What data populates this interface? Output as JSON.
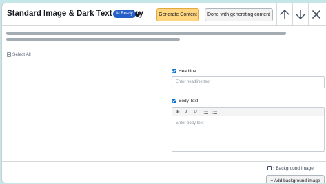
{
  "header": {
    "title": "Standard Image & Dark Text Overlay",
    "badge": "AI Ready",
    "info_icon": "info-icon",
    "generate_label": "Generate Content",
    "done_label": "Done with generating content",
    "up_icon": "arrow-up-icon",
    "down_icon": "arrow-down-icon",
    "close_icon": "close-icon"
  },
  "select_all": "Select All",
  "headline": {
    "label": "Headline",
    "checked": true,
    "placeholder": "Enter headline text"
  },
  "body_text": {
    "label": "Body Text",
    "checked": true,
    "toolbar": {
      "bold": "B",
      "italic": "I",
      "underline": "U"
    },
    "placeholder": "Enter body text"
  },
  "background": {
    "label": "* Background Image",
    "checked": false,
    "add_label": "+ Add background image"
  },
  "colors": {
    "accent_blue": "#0972d3",
    "badge_blue": "#2560c9",
    "generate_bg": "#ffd580",
    "page_bg": "#c6e7e7"
  }
}
